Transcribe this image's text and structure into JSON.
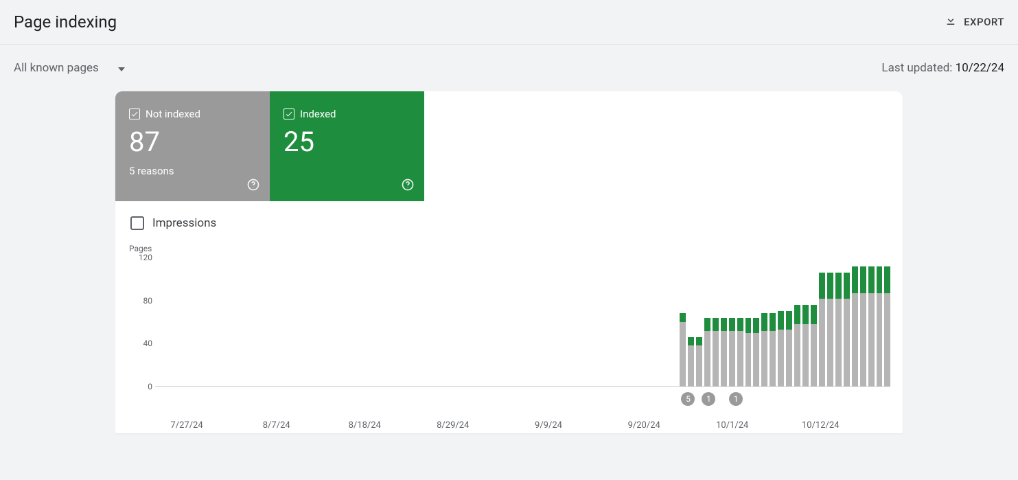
{
  "header": {
    "title": "Page indexing",
    "export": "EXPORT"
  },
  "filter": {
    "label": "All known pages"
  },
  "last_updated": {
    "prefix": "Last updated: ",
    "date": "10/22/24"
  },
  "tiles": {
    "not_indexed": {
      "label": "Not indexed",
      "value": "87",
      "sub": "5 reasons"
    },
    "indexed": {
      "label": "Indexed",
      "value": "25"
    }
  },
  "impressions": {
    "label": "Impressions"
  },
  "chart_data": {
    "type": "bar",
    "ylabel": "Pages",
    "ylim": [
      0,
      120
    ],
    "yticks": [
      "0",
      "40",
      "80",
      "120"
    ],
    "xticks": [
      {
        "label": "7/27/24",
        "pos": 4.3
      },
      {
        "label": "8/7/24",
        "pos": 16.5
      },
      {
        "label": "8/18/24",
        "pos": 28.5
      },
      {
        "label": "8/29/24",
        "pos": 40.5
      },
      {
        "label": "9/9/24",
        "pos": 53.5
      },
      {
        "label": "9/20/24",
        "pos": 66.5
      },
      {
        "label": "10/1/24",
        "pos": 78.5
      },
      {
        "label": "10/12/24",
        "pos": 90.5
      }
    ],
    "series": [
      {
        "name": "Not indexed",
        "color": "#b5b5b5"
      },
      {
        "name": "Indexed",
        "color": "#1e8e3e"
      }
    ],
    "categories": [
      "7/24/24",
      "7/25/24",
      "7/26/24",
      "7/27/24",
      "7/28/24",
      "7/29/24",
      "7/30/24",
      "7/31/24",
      "8/1/24",
      "8/2/24",
      "8/3/24",
      "8/4/24",
      "8/5/24",
      "8/6/24",
      "8/7/24",
      "8/8/24",
      "8/9/24",
      "8/10/24",
      "8/11/24",
      "8/12/24",
      "8/13/24",
      "8/14/24",
      "8/15/24",
      "8/16/24",
      "8/17/24",
      "8/18/24",
      "8/19/24",
      "8/20/24",
      "8/21/24",
      "8/22/24",
      "8/23/24",
      "8/24/24",
      "8/25/24",
      "8/26/24",
      "8/27/24",
      "8/28/24",
      "8/29/24",
      "8/30/24",
      "8/31/24",
      "9/1/24",
      "9/2/24",
      "9/3/24",
      "9/4/24",
      "9/5/24",
      "9/6/24",
      "9/7/24",
      "9/8/24",
      "9/9/24",
      "9/10/24",
      "9/11/24",
      "9/12/24",
      "9/13/24",
      "9/14/24",
      "9/15/24",
      "9/16/24",
      "9/17/24",
      "9/18/24",
      "9/19/24",
      "9/20/24",
      "9/21/24",
      "9/22/24",
      "9/23/24",
      "9/24/24",
      "9/25/24",
      "9/26/24",
      "9/27/24",
      "9/28/24",
      "9/29/24",
      "9/30/24",
      "10/1/24",
      "10/2/24",
      "10/3/24",
      "10/4/24",
      "10/5/24",
      "10/6/24",
      "10/7/24",
      "10/8/24",
      "10/9/24",
      "10/10/24",
      "10/11/24",
      "10/12/24",
      "10/13/24",
      "10/14/24",
      "10/15/24",
      "10/16/24",
      "10/17/24",
      "10/18/24",
      "10/19/24",
      "10/20/24",
      "10/21/24"
    ],
    "values": [
      {
        "ni": 0,
        "ix": 0
      },
      {
        "ni": 0,
        "ix": 0
      },
      {
        "ni": 0,
        "ix": 0
      },
      {
        "ni": 0,
        "ix": 0
      },
      {
        "ni": 0,
        "ix": 0
      },
      {
        "ni": 0,
        "ix": 0
      },
      {
        "ni": 0,
        "ix": 0
      },
      {
        "ni": 0,
        "ix": 0
      },
      {
        "ni": 0,
        "ix": 0
      },
      {
        "ni": 0,
        "ix": 0
      },
      {
        "ni": 0,
        "ix": 0
      },
      {
        "ni": 0,
        "ix": 0
      },
      {
        "ni": 0,
        "ix": 0
      },
      {
        "ni": 0,
        "ix": 0
      },
      {
        "ni": 0,
        "ix": 0
      },
      {
        "ni": 0,
        "ix": 0
      },
      {
        "ni": 0,
        "ix": 0
      },
      {
        "ni": 0,
        "ix": 0
      },
      {
        "ni": 0,
        "ix": 0
      },
      {
        "ni": 0,
        "ix": 0
      },
      {
        "ni": 0,
        "ix": 0
      },
      {
        "ni": 0,
        "ix": 0
      },
      {
        "ni": 0,
        "ix": 0
      },
      {
        "ni": 0,
        "ix": 0
      },
      {
        "ni": 0,
        "ix": 0
      },
      {
        "ni": 0,
        "ix": 0
      },
      {
        "ni": 0,
        "ix": 0
      },
      {
        "ni": 0,
        "ix": 0
      },
      {
        "ni": 0,
        "ix": 0
      },
      {
        "ni": 0,
        "ix": 0
      },
      {
        "ni": 0,
        "ix": 0
      },
      {
        "ni": 0,
        "ix": 0
      },
      {
        "ni": 0,
        "ix": 0
      },
      {
        "ni": 0,
        "ix": 0
      },
      {
        "ni": 0,
        "ix": 0
      },
      {
        "ni": 0,
        "ix": 0
      },
      {
        "ni": 0,
        "ix": 0
      },
      {
        "ni": 0,
        "ix": 0
      },
      {
        "ni": 0,
        "ix": 0
      },
      {
        "ni": 0,
        "ix": 0
      },
      {
        "ni": 0,
        "ix": 0
      },
      {
        "ni": 0,
        "ix": 0
      },
      {
        "ni": 0,
        "ix": 0
      },
      {
        "ni": 0,
        "ix": 0
      },
      {
        "ni": 0,
        "ix": 0
      },
      {
        "ni": 0,
        "ix": 0
      },
      {
        "ni": 0,
        "ix": 0
      },
      {
        "ni": 0,
        "ix": 0
      },
      {
        "ni": 0,
        "ix": 0
      },
      {
        "ni": 0,
        "ix": 0
      },
      {
        "ni": 0,
        "ix": 0
      },
      {
        "ni": 0,
        "ix": 0
      },
      {
        "ni": 0,
        "ix": 0
      },
      {
        "ni": 0,
        "ix": 0
      },
      {
        "ni": 0,
        "ix": 0
      },
      {
        "ni": 0,
        "ix": 0
      },
      {
        "ni": 0,
        "ix": 0
      },
      {
        "ni": 0,
        "ix": 0
      },
      {
        "ni": 0,
        "ix": 0
      },
      {
        "ni": 0,
        "ix": 0
      },
      {
        "ni": 0,
        "ix": 0
      },
      {
        "ni": 0,
        "ix": 0
      },
      {
        "ni": 0,
        "ix": 0
      },
      {
        "ni": 0,
        "ix": 0
      },
      {
        "ni": 60,
        "ix": 8
      },
      {
        "ni": 38,
        "ix": 8
      },
      {
        "ni": 38,
        "ix": 8
      },
      {
        "ni": 52,
        "ix": 12
      },
      {
        "ni": 52,
        "ix": 12
      },
      {
        "ni": 52,
        "ix": 12
      },
      {
        "ni": 52,
        "ix": 12
      },
      {
        "ni": 52,
        "ix": 12
      },
      {
        "ni": 50,
        "ix": 14
      },
      {
        "ni": 50,
        "ix": 14
      },
      {
        "ni": 52,
        "ix": 16
      },
      {
        "ni": 52,
        "ix": 16
      },
      {
        "ni": 53,
        "ix": 17
      },
      {
        "ni": 53,
        "ix": 17
      },
      {
        "ni": 58,
        "ix": 18
      },
      {
        "ni": 58,
        "ix": 18
      },
      {
        "ni": 58,
        "ix": 18
      },
      {
        "ni": 82,
        "ix": 24
      },
      {
        "ni": 82,
        "ix": 24
      },
      {
        "ni": 82,
        "ix": 24
      },
      {
        "ni": 82,
        "ix": 24
      },
      {
        "ni": 87,
        "ix": 25
      },
      {
        "ni": 87,
        "ix": 25
      },
      {
        "ni": 87,
        "ix": 25
      },
      {
        "ni": 87,
        "ix": 25
      },
      {
        "ni": 87,
        "ix": 25
      }
    ],
    "markers": [
      {
        "label": "5",
        "pos": 72.5
      },
      {
        "label": "1",
        "pos": 75.3
      },
      {
        "label": "1",
        "pos": 79.0
      }
    ]
  }
}
